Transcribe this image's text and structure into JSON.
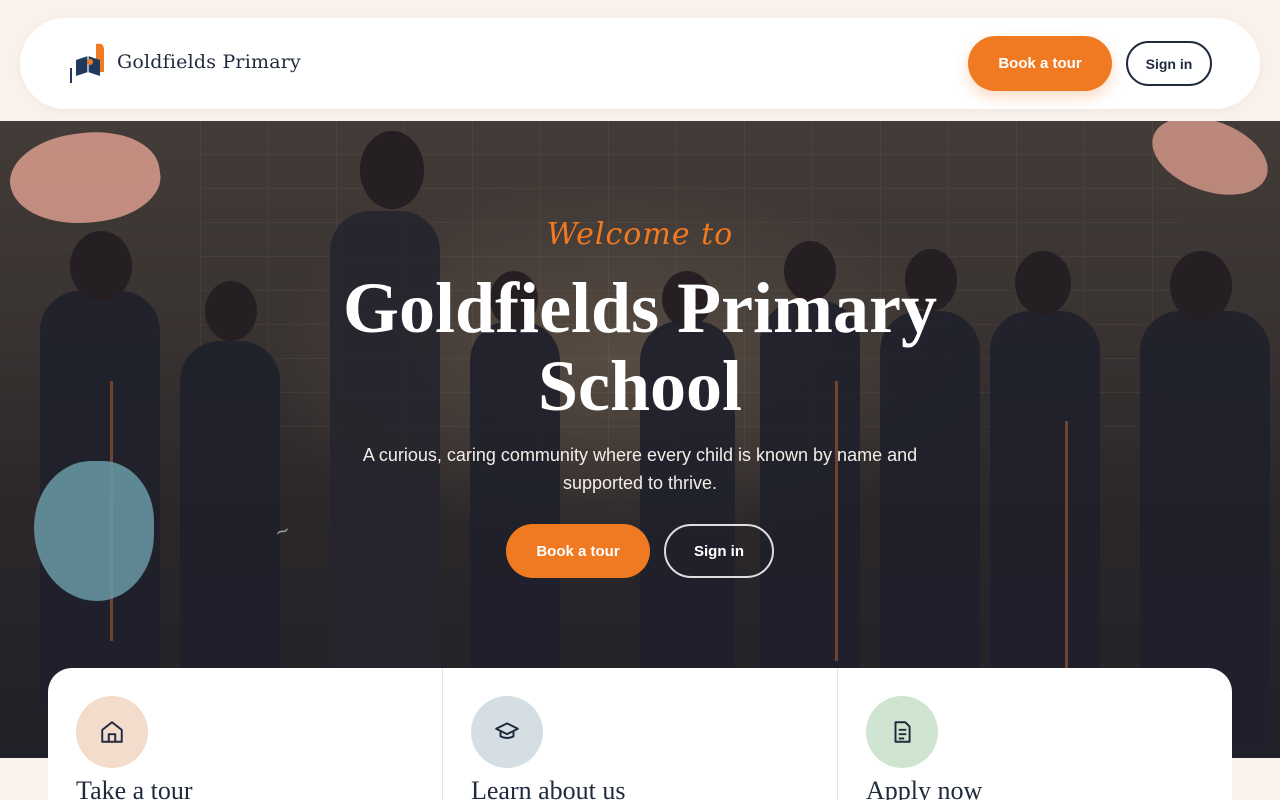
{
  "header": {
    "brand": "Goldfields Primary",
    "tour_button": "Book a tour",
    "signin_button": "Sign in"
  },
  "hero": {
    "welcome": "Welcome to",
    "title": "Goldfields Primary School",
    "subtitle": "A curious, caring community where every child is known by name and supported to thrive.",
    "tour_button": "Book a tour",
    "signin_button": "Sign in"
  },
  "cards": [
    {
      "title": "Take a tour",
      "icon": "home-icon",
      "color": "#f4dccd"
    },
    {
      "title": "Learn about us",
      "icon": "graduation-cap-icon",
      "color": "#d5dee3"
    },
    {
      "title": "Apply now",
      "icon": "document-icon",
      "color": "#cfe4d1"
    }
  ],
  "colors": {
    "accent": "#f07a21",
    "navy": "#1f2a3c",
    "background": "#f8f1ec"
  }
}
